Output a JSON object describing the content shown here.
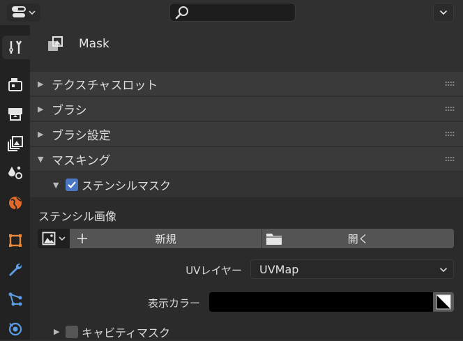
{
  "header": {
    "editor_type_icon": "properties-editor-icon",
    "search": {
      "value": "",
      "placeholder": ""
    }
  },
  "sidebar": {
    "tabs": [
      {
        "name": "tool",
        "icon": "tool-settings-icon",
        "active": true
      },
      {
        "name": "render",
        "icon": "render-icon",
        "active": false
      },
      {
        "name": "output",
        "icon": "output-icon",
        "active": false
      },
      {
        "name": "view-layer",
        "icon": "view-layer-icon",
        "active": false
      },
      {
        "name": "scene",
        "icon": "scene-icon",
        "active": false
      },
      {
        "name": "world",
        "icon": "world-icon",
        "active": false
      },
      {
        "name": "object",
        "icon": "object-icon",
        "active": false
      },
      {
        "name": "modifiers",
        "icon": "wrench-icon",
        "active": false
      },
      {
        "name": "particles",
        "icon": "particles-icon",
        "active": false
      },
      {
        "name": "physics",
        "icon": "physics-icon",
        "active": false
      }
    ]
  },
  "main": {
    "mode_title": "Mask",
    "panels": [
      {
        "label": "テクスチャスロット",
        "expanded": false
      },
      {
        "label": "ブラシ",
        "expanded": false
      },
      {
        "label": "ブラシ設定",
        "expanded": false
      },
      {
        "label": "マスキング",
        "expanded": true
      }
    ],
    "stencil_mask": {
      "label": "ステンシルマスク",
      "checked": true,
      "expanded": true,
      "image_section_label": "ステンシル画像",
      "new_label": "新規",
      "open_label": "開く",
      "uv_layer_label": "UVレイヤー",
      "uv_layer_value": "UVMap",
      "display_color_label": "表示カラー",
      "display_color": "#000000"
    },
    "cavity_mask": {
      "label": "キャビティマスク",
      "checked": false,
      "expanded": false
    }
  },
  "colors": {
    "accent": "#4a77c4",
    "background": "#303030",
    "sidebar": "#222222",
    "panel_header": "#3a3a3a",
    "button": "#545454"
  }
}
